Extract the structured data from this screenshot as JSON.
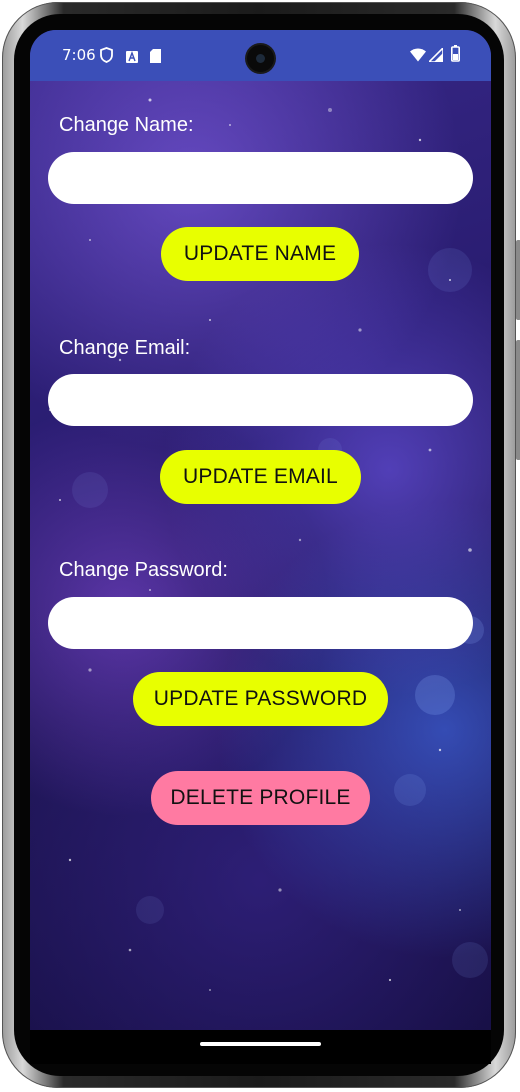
{
  "status_bar": {
    "time": "7:06",
    "icons_left": [
      "shield-icon",
      "font-a-icon",
      "sd-card-icon"
    ],
    "icons_right": [
      "wifi-icon",
      "cell-signal-icon",
      "battery-icon"
    ]
  },
  "colors": {
    "status_bar_bg": "#3b4fb8",
    "update_button_bg": "#e8ff00",
    "delete_button_bg": "#ff7aa2",
    "label_text": "#ffffff"
  },
  "form": {
    "name": {
      "label": "Change Name:",
      "value": "",
      "button": "UPDATE NAME"
    },
    "email": {
      "label": "Change Email:",
      "value": "",
      "button": "UPDATE EMAIL"
    },
    "password": {
      "label": "Change Password:",
      "value": "",
      "button": "UPDATE PASSWORD"
    },
    "delete_button": "DELETE PROFILE"
  }
}
